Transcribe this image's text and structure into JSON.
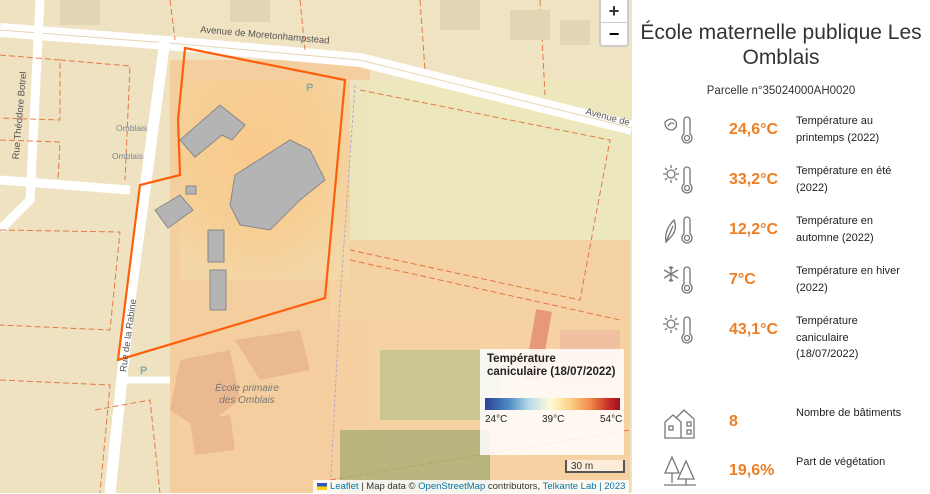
{
  "map": {
    "zoom_in": "+",
    "zoom_out": "−",
    "labels": {
      "avenue_moreton": "Avenue de Moretonhampstead",
      "avenue_right": "Avenue de",
      "rue_theodore": "Rue Théodore Botrel",
      "rue_rabine": "Rue de la Rabine",
      "omblais_1": "Omblais",
      "omblais_2": "Omblais",
      "ecole_primaire": "École primaire des Omblais",
      "p1": "P",
      "p2": "P"
    },
    "legend": {
      "title": "Température caniculaire (18/07/2022)",
      "min": "24°C",
      "mid": "39°C",
      "max": "54°C"
    },
    "scale": "30 m",
    "attribution": {
      "leaflet": "Leaflet",
      "sep1": " | Map data © ",
      "osm": "OpenStreetMap",
      "sep2": " contributors, ",
      "telkante": "Telkante Lab | 2023"
    }
  },
  "panel": {
    "title": "École maternelle publique Les Omblais",
    "parcel": "Parcelle n°35024000AH0020",
    "accent_color": "#ee7e22",
    "stats": [
      {
        "icon": "spring-thermometer-icon",
        "value": "24,6°C",
        "label": "Température au printemps (2022)"
      },
      {
        "icon": "summer-thermometer-icon",
        "value": "33,2°C",
        "label": "Température en été (2022)"
      },
      {
        "icon": "autumn-thermometer-icon",
        "value": "12,2°C",
        "label": "Température en automne (2022)"
      },
      {
        "icon": "winter-thermometer-icon",
        "value": "7°C",
        "label": "Température en hiver (2022)"
      },
      {
        "icon": "heatwave-thermometer-icon",
        "value": "43,1°C",
        "label": "Température caniculaire (18/07/2022)"
      },
      {
        "icon": "buildings-icon",
        "value": "8",
        "label": "Nombre de bâtiments"
      },
      {
        "icon": "trees-icon",
        "value": "19,6%",
        "label": "Part de végétation"
      }
    ]
  }
}
